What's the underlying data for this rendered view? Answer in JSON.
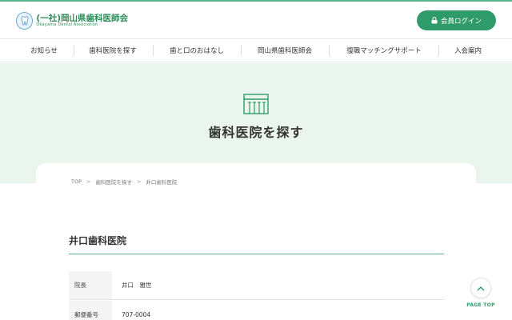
{
  "header": {
    "logo_text": "(一社)岡山県歯科医師会",
    "logo_subtext": "Okayama Dental Association",
    "login_label": "会員ログイン",
    "brand_color": "#2f9b6a"
  },
  "nav": {
    "items": [
      {
        "label": "お知らせ"
      },
      {
        "label": "歯科医院を探す"
      },
      {
        "label": "歯と口のおはなし"
      },
      {
        "label": "岡山県歯科医師会"
      },
      {
        "label": "復職マッチングサポート"
      },
      {
        "label": "入会案内"
      }
    ]
  },
  "hero": {
    "title": "歯科医院を探す",
    "icon": "clinic-building-icon",
    "background": "#eaf5ee"
  },
  "breadcrumb": {
    "items": [
      "TOP",
      "歯科医院を探す",
      "井口歯科医院"
    ],
    "separator": ">"
  },
  "clinic": {
    "name": "井口歯科医院",
    "rows": [
      {
        "label": "院長",
        "value": "井口　雅世"
      },
      {
        "label": "郵便番号",
        "value": "707-0004"
      }
    ]
  },
  "page_top": {
    "label": "PAGE TOP"
  }
}
